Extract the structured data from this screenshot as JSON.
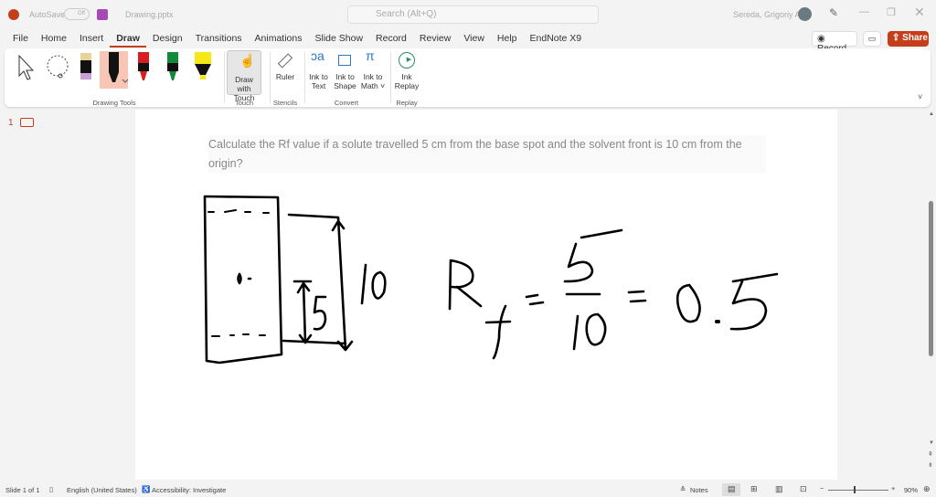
{
  "titlebar": {
    "autosave": "AutoSave",
    "toggle": "Off",
    "filename": "Drawing.pptx",
    "search_placeholder": "Search (Alt+Q)",
    "user": "Sereda, Grigoriy A"
  },
  "tabs": [
    "File",
    "Home",
    "Insert",
    "Draw",
    "Design",
    "Transitions",
    "Animations",
    "Slide Show",
    "Record",
    "Review",
    "View",
    "Help",
    "EndNote X9"
  ],
  "actions": {
    "record": "Record",
    "share": "Share"
  },
  "ribbon": {
    "groups": {
      "drawing_tools": "Drawing Tools",
      "touch": "Touch",
      "stencils": "Stencils",
      "convert": "Convert",
      "replay": "Replay"
    },
    "draw_with_touch": "Draw with Touch",
    "ruler": "Ruler",
    "ink_to_text": "Ink to Text",
    "ink_to_shape": "Ink to Shape",
    "ink_to_math": "Ink to Math",
    "ink_replay": "Ink Replay"
  },
  "thumbnails": {
    "slide_number": "1"
  },
  "slide": {
    "question": "Calculate the Rf value if a solute travelled 5 cm from the base spot and the solvent front is 10 cm from the origin?"
  },
  "status": {
    "slide": "Slide 1 of 1",
    "language": "English (United States)",
    "accessibility": "Accessibility: Investigate",
    "notes": "Notes",
    "zoom": "90%"
  }
}
